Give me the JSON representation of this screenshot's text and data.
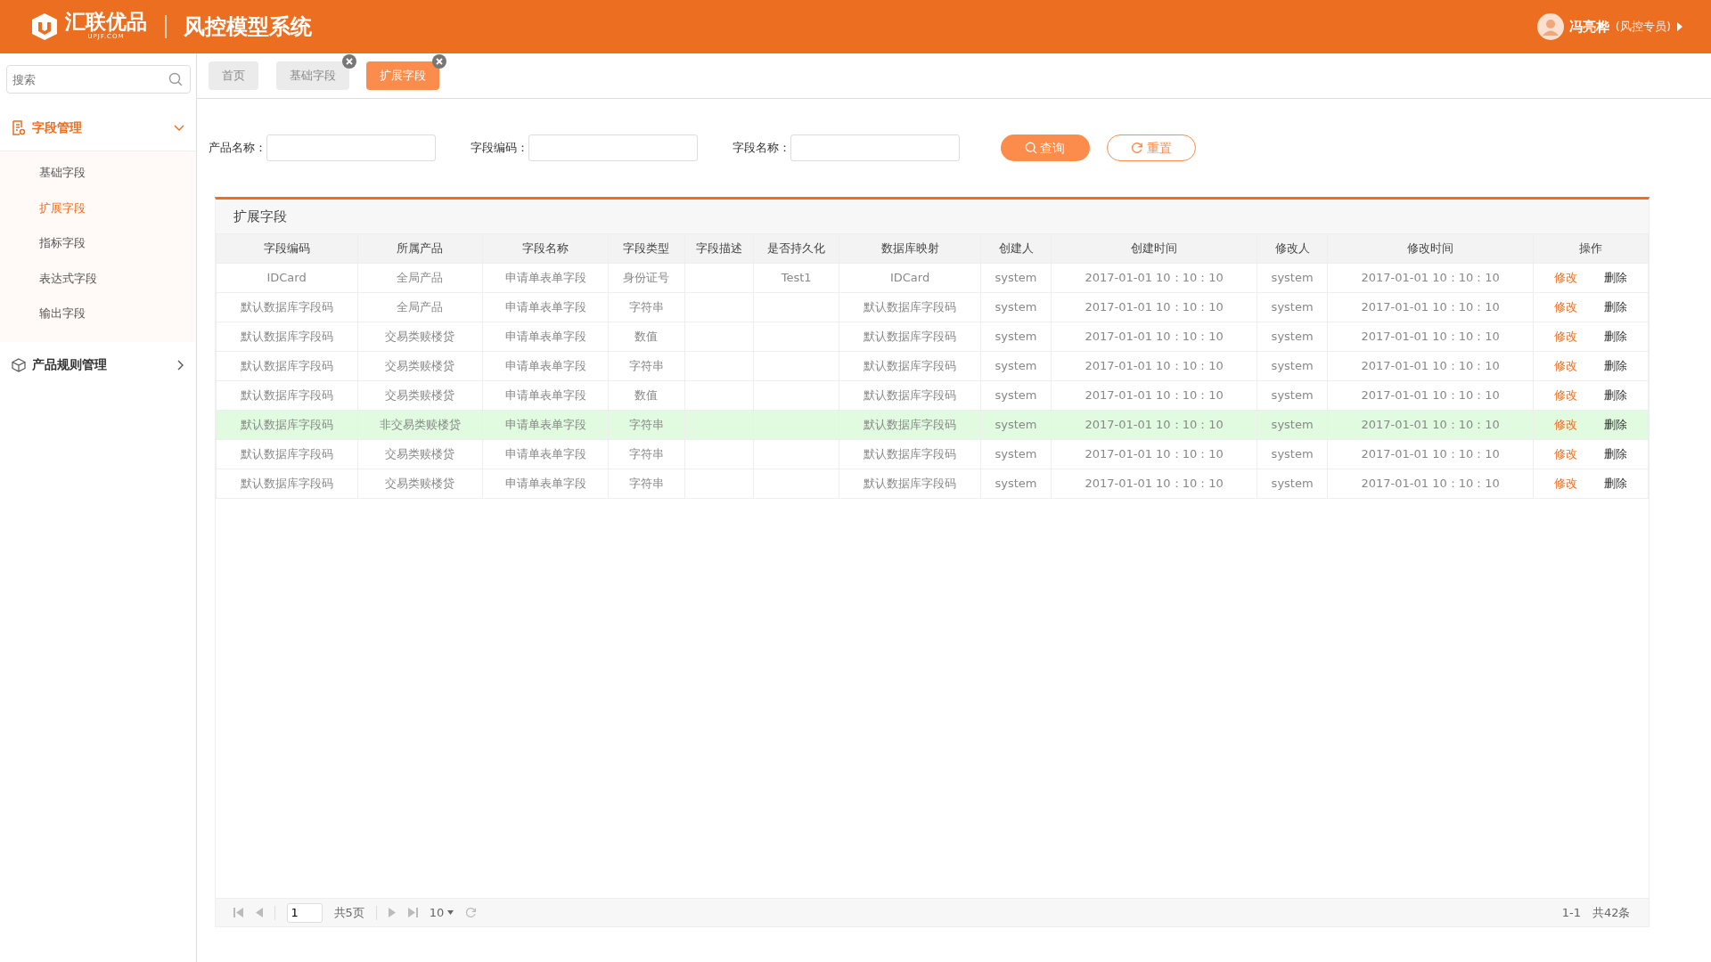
{
  "header": {
    "logo_text": "汇联优品",
    "logo_sub": "UPJF.COM",
    "system_title": "风控模型系统",
    "user_name": "冯亮桦",
    "user_role": "(风控专员)"
  },
  "sidebar": {
    "search_placeholder": "搜索",
    "groups": [
      {
        "label": "字段管理",
        "kind": "doc",
        "expanded": true,
        "children": [
          {
            "label": "基础字段",
            "selected": false
          },
          {
            "label": "扩展字段",
            "selected": true
          },
          {
            "label": "指标字段",
            "selected": false
          },
          {
            "label": "表达式字段",
            "selected": false
          },
          {
            "label": "输出字段",
            "selected": false
          }
        ]
      },
      {
        "label": "产品规则管理",
        "kind": "box",
        "expanded": false
      }
    ]
  },
  "tabs": [
    {
      "label": "首页",
      "selected": false,
      "closable": false
    },
    {
      "label": "基础字段",
      "selected": false,
      "closable": true
    },
    {
      "label": "扩展字段",
      "selected": true,
      "closable": true
    }
  ],
  "filters": [
    {
      "label": "产品名称："
    },
    {
      "label": "字段编码："
    },
    {
      "label": "字段名称："
    }
  ],
  "buttons": {
    "query": "查询",
    "reset": "重置"
  },
  "table": {
    "title": "扩展字段",
    "columns": [
      "字段编码",
      "所属产品",
      "字段名称",
      "字段类型",
      "字段描述",
      "是否持久化",
      "数据库映射",
      "创建人",
      "创建时间",
      "修改人",
      "修改时间",
      "操作"
    ],
    "rows": [
      {
        "selected": false,
        "cells": [
          "IDCard",
          "全局产品",
          "申请单表单字段",
          "身份证号",
          "",
          "Test1",
          "IDCard",
          "system",
          "2017-01-01 10：10：10",
          "system",
          "2017-01-01 10：10：10"
        ],
        "actions": [
          "修改",
          "删除"
        ]
      },
      {
        "selected": false,
        "cells": [
          "默认数据库字段码",
          "全局产品",
          "申请单表单字段",
          "字符串",
          "",
          "",
          "默认数据库字段码",
          "system",
          "2017-01-01 10：10：10",
          "system",
          "2017-01-01 10：10：10"
        ],
        "actions": [
          "修改",
          "删除"
        ]
      },
      {
        "selected": false,
        "cells": [
          "默认数据库字段码",
          "交易类赎楼贷",
          "申请单表单字段",
          "数值",
          "",
          "",
          "默认数据库字段码",
          "system",
          "2017-01-01 10：10：10",
          "system",
          "2017-01-01 10：10：10"
        ],
        "actions": [
          "修改",
          "删除"
        ]
      },
      {
        "selected": false,
        "cells": [
          "默认数据库字段码",
          "交易类赎楼贷",
          "申请单表单字段",
          "字符串",
          "",
          "",
          "默认数据库字段码",
          "system",
          "2017-01-01 10：10：10",
          "system",
          "2017-01-01 10：10：10"
        ],
        "actions": [
          "修改",
          "删除"
        ]
      },
      {
        "selected": false,
        "cells": [
          "默认数据库字段码",
          "交易类赎楼贷",
          "申请单表单字段",
          "数值",
          "",
          "",
          "默认数据库字段码",
          "system",
          "2017-01-01 10：10：10",
          "system",
          "2017-01-01 10：10：10"
        ],
        "actions": [
          "修改",
          "删除"
        ]
      },
      {
        "selected": true,
        "cells": [
          "默认数据库字段码",
          "非交易类赎楼贷",
          "申请单表单字段",
          "字符串",
          "",
          "",
          "默认数据库字段码",
          "system",
          "2017-01-01 10：10：10",
          "system",
          "2017-01-01 10：10：10"
        ],
        "actions": [
          "修改",
          "删除"
        ]
      },
      {
        "selected": false,
        "cells": [
          "默认数据库字段码",
          "交易类赎楼贷",
          "申请单表单字段",
          "字符串",
          "",
          "",
          "默认数据库字段码",
          "system",
          "2017-01-01 10：10：10",
          "system",
          "2017-01-01 10：10：10"
        ],
        "actions": [
          "修改",
          "删除"
        ]
      },
      {
        "selected": false,
        "cells": [
          "默认数据库字段码",
          "交易类赎楼贷",
          "申请单表单字段",
          "字符串",
          "",
          "",
          "默认数据库字段码",
          "system",
          "2017-01-01 10：10：10",
          "system",
          "2017-01-01 10：10：10"
        ],
        "actions": [
          "修改",
          "删除"
        ]
      }
    ]
  },
  "pagination": {
    "page": "1",
    "total_pages": "共5页",
    "page_size": "10",
    "range": "1-1",
    "total": "共42条"
  }
}
